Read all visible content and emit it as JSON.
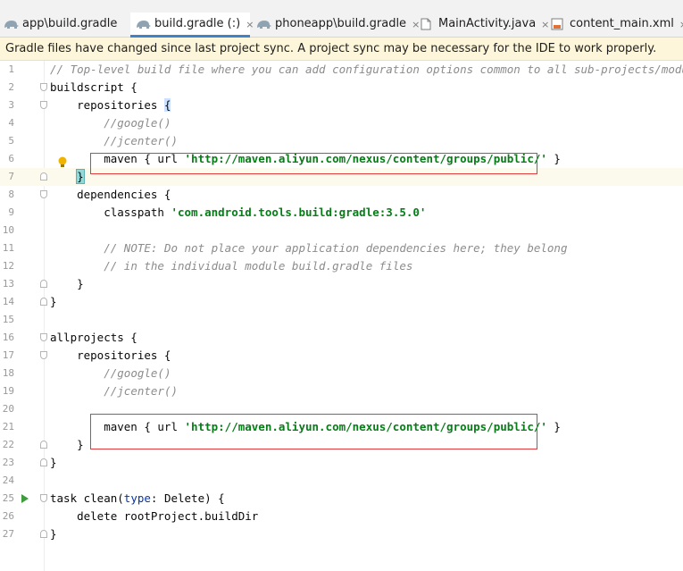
{
  "tabs": [
    {
      "label": "app\\build.gradle",
      "icon": "gradle-elephant-icon",
      "active": false
    },
    {
      "label": "build.gradle (:)",
      "icon": "gradle-elephant-icon",
      "active": true
    },
    {
      "label": "phoneapp\\build.gradle",
      "icon": "gradle-elephant-icon",
      "active": false
    },
    {
      "label": "MainActivity.java",
      "icon": "java-file-icon",
      "active": false
    },
    {
      "label": "content_main.xml",
      "icon": "xml-layout-icon",
      "active": false
    }
  ],
  "tab_close_glyph": "×",
  "banner": {
    "text": "Gradle files have changed since last project sync. A project sync may be necessary for the IDE to work properly."
  },
  "editor": {
    "line_numbers": [
      "1",
      "2",
      "3",
      "4",
      "5",
      "6",
      "7",
      "8",
      "9",
      "10",
      "11",
      "12",
      "13",
      "14",
      "15",
      "16",
      "17",
      "18",
      "19",
      "20",
      "21",
      "22",
      "23",
      "24",
      "25",
      "26",
      "27"
    ],
    "lines": [
      "// Top-level build file where you can add configuration options common to all sub-projects/modules.",
      "buildscript {",
      "    repositories {",
      "        //google()",
      "        //jcenter()",
      "        maven { url 'http://maven.aliyun.com/nexus/content/groups/public/' }",
      "    }",
      "    dependencies {",
      "        classpath 'com.android.tools.build:gradle:3.5.0'",
      "",
      "        // NOTE: Do not place your application dependencies here; they belong",
      "        // in the individual module build.gradle files",
      "    }",
      "}",
      "",
      "allprojects {",
      "    repositories {",
      "        //google()",
      "        //jcenter()",
      "",
      "        maven { url 'http://maven.aliyun.com/nexus/content/groups/public/' }",
      "    }",
      "}",
      "",
      "task clean(type: Delete) {",
      "    delete rootProject.buildDir",
      "}"
    ],
    "current_line": 7,
    "colors": {
      "comment": "#8c8c8c",
      "string": "#067d17",
      "keyword": "#0033b3",
      "highlight_box": "#e33b3b",
      "current_line_bg": "#fcfaed",
      "banner_bg": "#fdf6da",
      "active_tab_underline": "#4083c9"
    },
    "gutter_icons": {
      "line_6": "intention-bulb-icon",
      "line_25": "run-gutter-icon"
    }
  }
}
